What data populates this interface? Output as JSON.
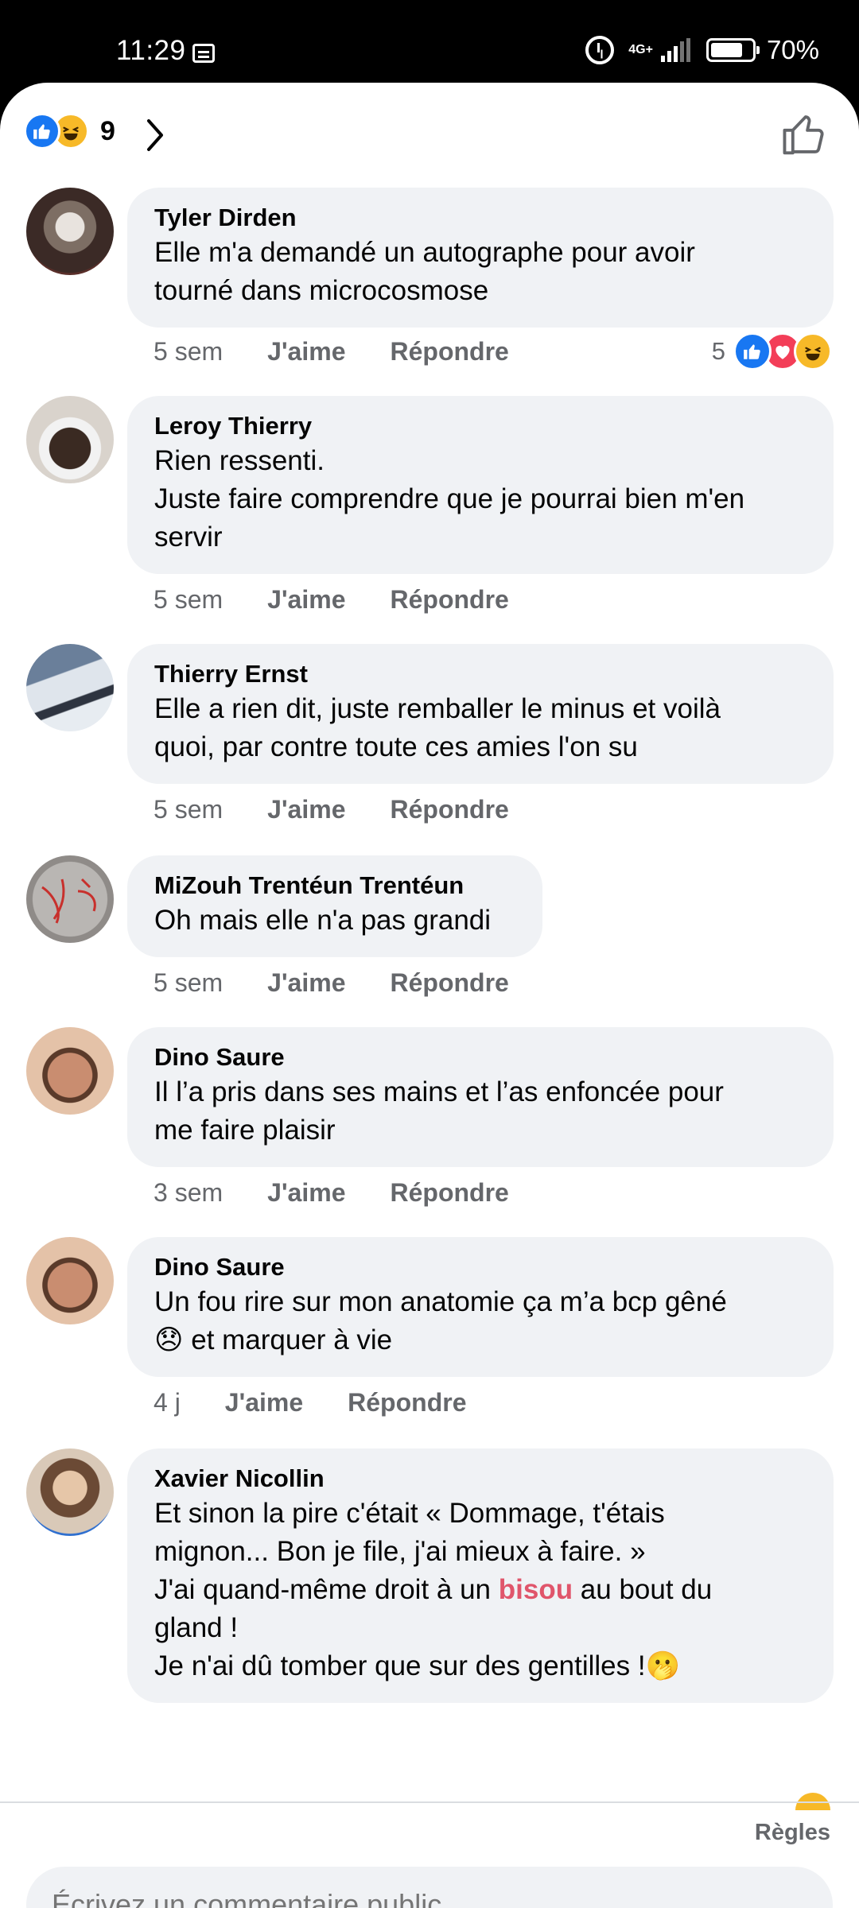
{
  "status_bar": {
    "time": "11:29",
    "network": "4G+",
    "battery_pct": "70%",
    "battery_level": 0.7
  },
  "header": {
    "reaction_count": "9",
    "reaction_icons": [
      "like",
      "haha"
    ],
    "chevron_icon": "chevron-right-icon",
    "like_icon": "thumbs-up-outline-icon"
  },
  "comments": [
    {
      "author": "Tyler Dirden",
      "text": "Elle m'a demandé un autographe pour avoir\ntourné dans microcosmose",
      "age": "5 sem",
      "like_label": "J'aime",
      "reply_label": "Répondre",
      "reaction_count": "5",
      "reactions": [
        "like",
        "love",
        "haha"
      ]
    },
    {
      "author": "Leroy Thierry",
      "text": "Rien ressenti.\nJuste faire comprendre que je pourrai bien m'en\nservir",
      "age": "5 sem",
      "like_label": "J'aime",
      "reply_label": "Répondre"
    },
    {
      "author": "Thierry Ernst",
      "text": "Elle a rien dit, juste remballer le minus et voilà\nquoi, par contre toute ces amies l'on su",
      "age": "5 sem",
      "like_label": "J'aime",
      "reply_label": "Répondre"
    },
    {
      "author": "MiZouh Trentéun Trentéun",
      "text": "Oh mais elle n'a pas grandi",
      "age": "5 sem",
      "like_label": "J'aime",
      "reply_label": "Répondre"
    },
    {
      "author": "Dino Saure",
      "text": "Il l’a pris dans ses mains et l’as enfoncée pour\nme faire plaisir",
      "age": "3 sem",
      "like_label": "J'aime",
      "reply_label": "Répondre"
    },
    {
      "author": "Dino Saure",
      "text_line1": "Un fou rire sur mon anatomie ça m’a bcp gêné",
      "emoji": "😞",
      "text_line2": " et marquer à vie",
      "age": "4 j",
      "like_label": "J'aime",
      "reply_label": "Répondre"
    },
    {
      "author": "Xavier Nicollin",
      "text_a": "Et sinon la pire c'était « Dommage, t'étais\nmignon... Bon je file, j'ai mieux à faire. »\nJ'ai quand-même droit à un ",
      "highlight": "bisou",
      "text_b": " au bout du\ngland !\nJe n'ai dû tomber que sur des gentilles !",
      "emoji_end": "🫢"
    }
  ],
  "footer": {
    "rules_label": "Règles",
    "input_placeholder": "Écrivez un commentaire public..."
  }
}
